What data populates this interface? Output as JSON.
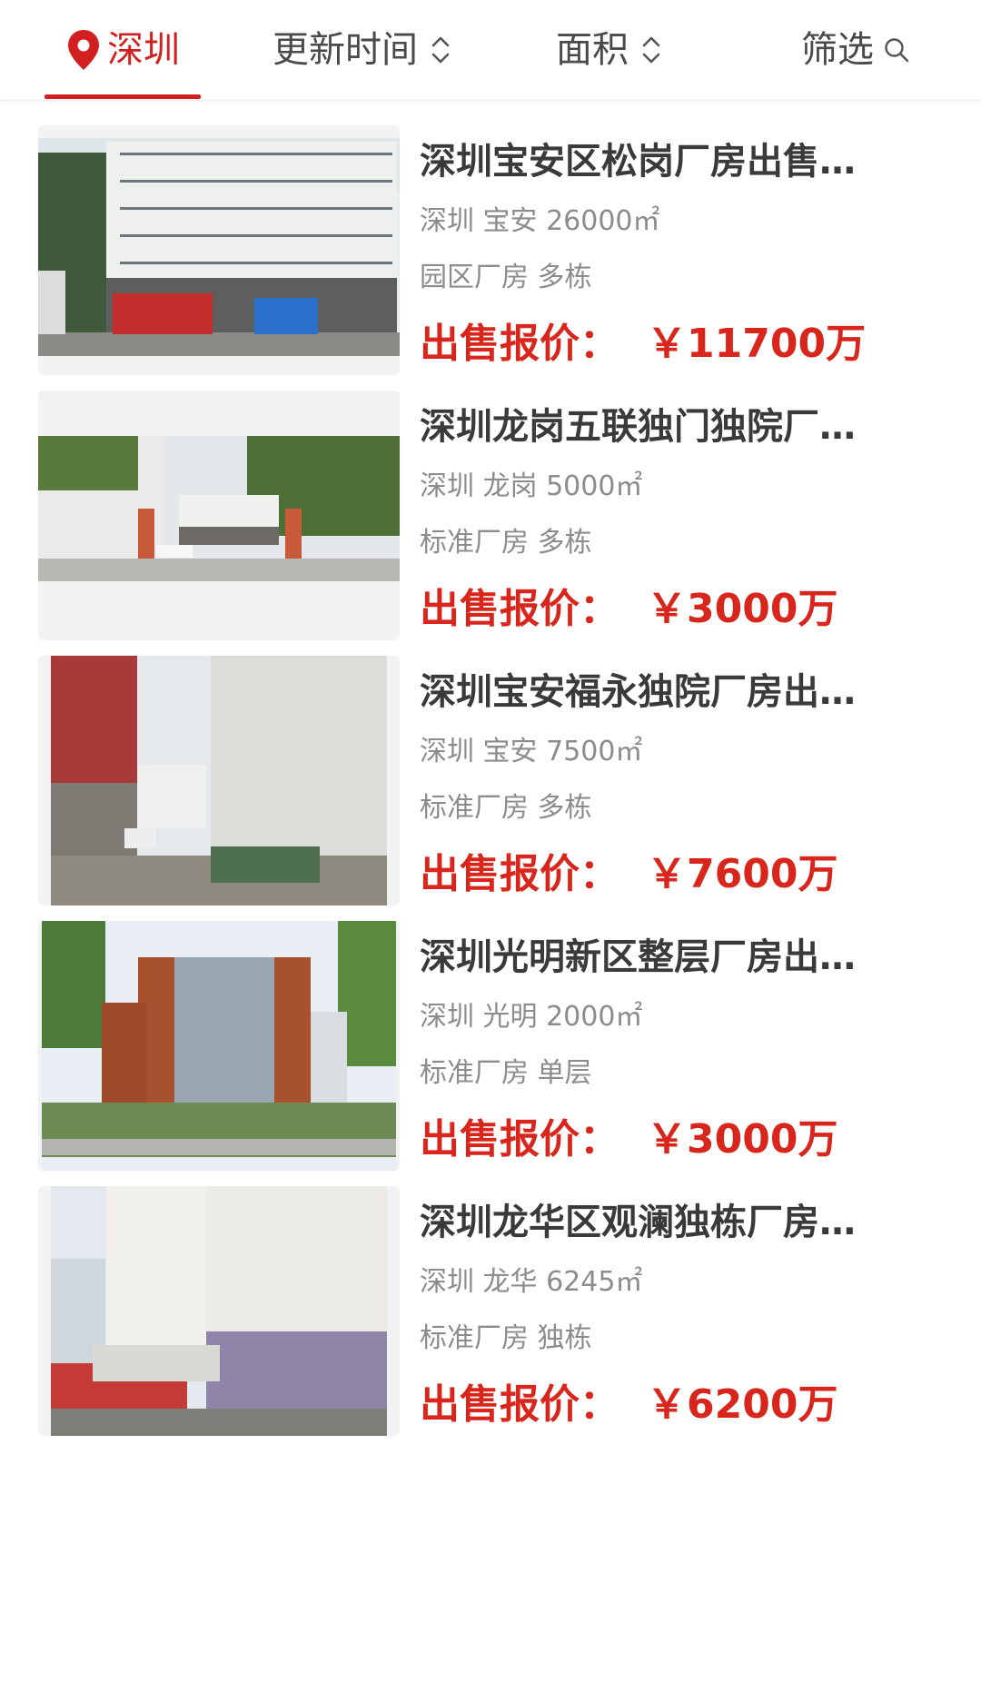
{
  "tabs": {
    "city": "深圳",
    "update_time": "更新时间",
    "area": "面积",
    "filter": "筛选"
  },
  "colors": {
    "accent": "#d21f1f",
    "price": "#d9261c",
    "title": "#3a3a3a",
    "meta": "#8c8c8c"
  },
  "listings": [
    {
      "title": "深圳宝安区松岗厂房出售…",
      "location": "深圳 宝安 26000㎡",
      "type": "园区厂房 多栋",
      "price_label": "出售报价：",
      "price_value": "￥11700万"
    },
    {
      "title": "深圳龙岗五联独门独院厂…",
      "location": "深圳 龙岗 5000㎡",
      "type": "标准厂房 多栋",
      "price_label": "出售报价：",
      "price_value": "￥3000万"
    },
    {
      "title": "深圳宝安福永独院厂房出…",
      "location": "深圳 宝安 7500㎡",
      "type": "标准厂房 多栋",
      "price_label": "出售报价：",
      "price_value": "￥7600万"
    },
    {
      "title": "深圳光明新区整层厂房出…",
      "location": "深圳 光明 2000㎡",
      "type": "标准厂房 单层",
      "price_label": "出售报价：",
      "price_value": "￥3000万"
    },
    {
      "title": "深圳龙华区观澜独栋厂房…",
      "location": "深圳 龙华 6245㎡",
      "type": "标准厂房 独栋",
      "price_label": "出售报价：",
      "price_value": "￥6200万"
    }
  ]
}
